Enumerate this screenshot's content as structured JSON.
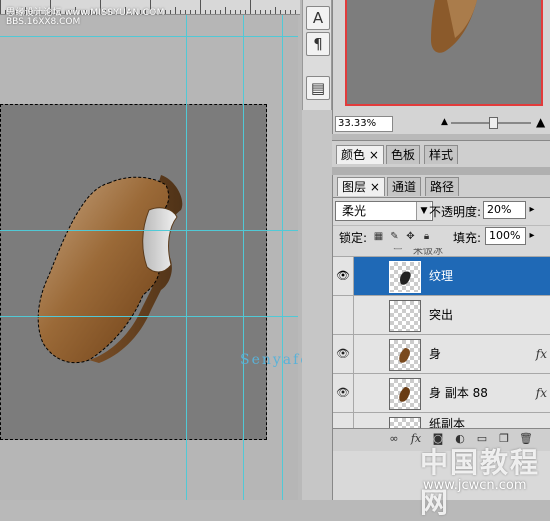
{
  "watermarks": {
    "top_left_1": "思缘设计论坛 www.MISSYUAN.COM",
    "top_left_2": "BBS.16XX8.COM",
    "logo_text": "Senyafou",
    "bottom_right_1": "中国教程网",
    "bottom_right_2": "www.jcwcn.com"
  },
  "toolbar": {
    "buttons": [
      {
        "name": "character-icon",
        "glyph": "A"
      },
      {
        "name": "paragraph-icon",
        "glyph": "¶"
      },
      {
        "name": "layer-comps-icon",
        "glyph": "▤"
      }
    ]
  },
  "navigator": {
    "zoom": "33.33%"
  },
  "color_panel": {
    "tabs": [
      {
        "label": "颜色",
        "close": "×",
        "active": true
      },
      {
        "label": "色板",
        "active": false
      },
      {
        "label": "样式",
        "active": false
      }
    ]
  },
  "layers_panel": {
    "tabs": [
      {
        "label": "图层",
        "close": "×",
        "active": true
      },
      {
        "label": "通道",
        "active": false
      },
      {
        "label": "路径",
        "active": false
      }
    ],
    "blend_mode": "柔光",
    "opacity_label": "不透明度:",
    "opacity_value": "20%",
    "lock_label": "锁定:",
    "fill_label": "填充:",
    "fill_value": "100%",
    "group_label": "米饭冰",
    "layers": [
      {
        "name": "纹理",
        "selected": true,
        "visible": true,
        "fx": ""
      },
      {
        "name": "突出",
        "selected": false,
        "visible": false,
        "fx": ""
      },
      {
        "name": "身",
        "selected": false,
        "visible": true,
        "fx": "fx"
      },
      {
        "name": "身 副本 88",
        "selected": false,
        "visible": true,
        "fx": "fx"
      },
      {
        "name": "纸副本",
        "selected": false,
        "visible": false,
        "fx": ""
      }
    ]
  },
  "colors": {
    "selection": "#1f69b6",
    "guide": "#51c9d6",
    "canvas": "#7c7c7c",
    "chocolate": "#8b5a2b"
  }
}
